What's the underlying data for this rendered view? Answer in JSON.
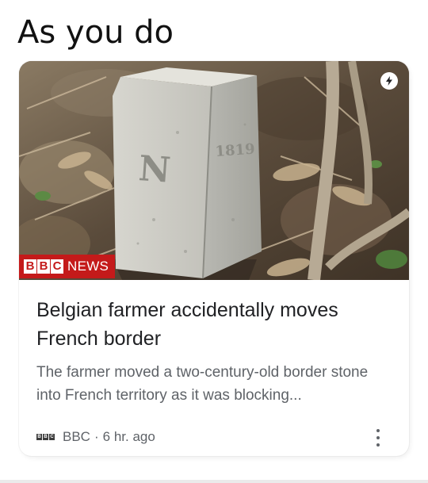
{
  "meme": {
    "caption": "As you do"
  },
  "news_card": {
    "source_logo": {
      "letters": [
        "B",
        "B",
        "C"
      ],
      "label": "NEWS"
    },
    "headline": "Belgian farmer accidentally moves French border",
    "snippet": "The farmer moved a two-century-old border stone into French territory as it was blocking...",
    "source": "BBC",
    "separator": "·",
    "age": "6 hr. ago",
    "image_icons": [
      "amp-lightning-icon"
    ],
    "footer_icons": [
      "bbc-favicon",
      "more-vert-icon"
    ],
    "colors": {
      "bbc_red": "#c41a1a",
      "headline": "#202124",
      "secondary_text": "#5f6368"
    }
  }
}
